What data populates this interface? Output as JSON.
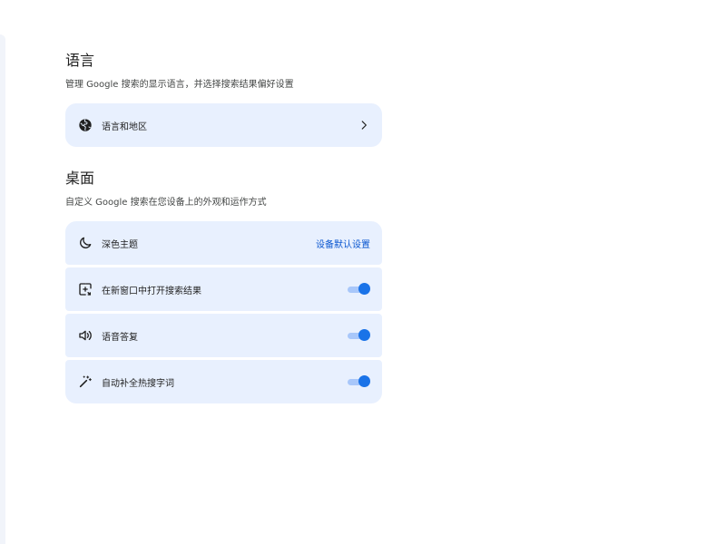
{
  "language_section": {
    "title": "语言",
    "description": "管理 Google 搜索的显示语言，并选择搜索结果偏好设置",
    "items": [
      {
        "label": "语言和地区",
        "icon": "globe-icon",
        "trailing_icon": "chevron-right-icon"
      }
    ]
  },
  "desktop_section": {
    "title": "桌面",
    "description": "自定义 Google 搜索在您设备上的外观和运作方式",
    "items": [
      {
        "label": "深色主题",
        "icon": "moon-icon",
        "value": "设备默认设置"
      },
      {
        "label": "在新窗口中打开搜索结果",
        "icon": "open-in-new-window-icon",
        "toggle": true
      },
      {
        "label": "语音答复",
        "icon": "speaker-icon",
        "toggle": true
      },
      {
        "label": "自动补全热搜字词",
        "icon": "magic-wand-icon",
        "toggle": true
      }
    ]
  },
  "colors": {
    "card_background": "#e8f0fe",
    "accent": "#1a73e8",
    "toggle_track": "#a8c7fa",
    "link_text": "#0b57d0"
  }
}
